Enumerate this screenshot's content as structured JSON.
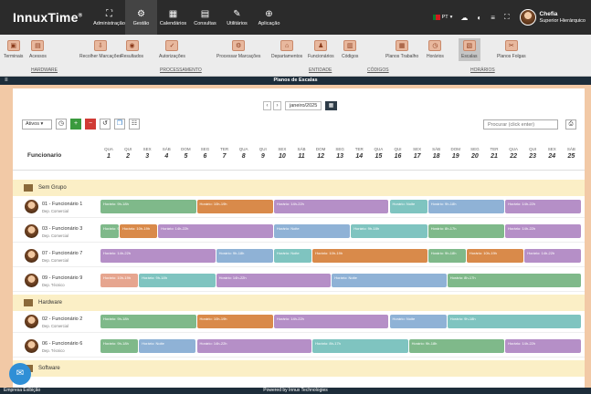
{
  "app": {
    "logo": "InnuxTime",
    "logo_mark": "®"
  },
  "modules": [
    {
      "label": "Administração",
      "icon": "sitemap-icon",
      "glyph": "⛶"
    },
    {
      "label": "Gestão",
      "icon": "gears-icon",
      "glyph": "⚙",
      "active": true
    },
    {
      "label": "Calendários",
      "icon": "calendar-icon",
      "glyph": "▦"
    },
    {
      "label": "Consultas",
      "icon": "report-icon",
      "glyph": "▤"
    },
    {
      "label": "Utilitários",
      "icon": "tools-icon",
      "glyph": "✎"
    },
    {
      "label": "Aplicação",
      "icon": "globe-icon",
      "glyph": "⊕"
    }
  ],
  "topright": {
    "lang": "PT",
    "user_name": "Chefia",
    "user_role": "Superior Hierárquico"
  },
  "submenu": {
    "items": [
      {
        "label": "Terminais",
        "icon": "terminal-icon"
      },
      {
        "label": "Acessos",
        "icon": "access-icon"
      },
      {
        "label": "Recolher Marcações",
        "icon": "collect-icon"
      },
      {
        "label": "Resultados",
        "icon": "results-icon"
      },
      {
        "label": "Autorizações",
        "icon": "authorization-icon"
      },
      {
        "label": "Processar Marcações",
        "icon": "process-icon"
      },
      {
        "label": "Departamentos",
        "icon": "department-icon"
      },
      {
        "label": "Funcionários",
        "icon": "employee-icon"
      },
      {
        "label": "Códigos",
        "icon": "codes-icon"
      },
      {
        "label": "Planos Trabalho",
        "icon": "work-plan-icon"
      },
      {
        "label": "Horários",
        "icon": "schedule-icon"
      },
      {
        "label": "Escalas",
        "icon": "rota-icon",
        "active": true
      },
      {
        "label": "Planos Folgas",
        "icon": "day-off-icon"
      }
    ],
    "groups": [
      "HARDWARE",
      "PROCESSAMENTO",
      "ENTIDADE",
      "CÓDIGOS",
      "HORÁRIOS"
    ]
  },
  "page_title": "Planos de Escalas",
  "date_nav": {
    "value": "janeiro/2025"
  },
  "filter": {
    "value": "Ativos"
  },
  "search": {
    "placeholder": "Procurar (click enter)"
  },
  "grid": {
    "column_header": "Funcionario",
    "weekdays": [
      "QUA",
      "QUI",
      "SEX",
      "SÁB",
      "DOM",
      "SEG",
      "TER",
      "QUA",
      "QUI",
      "SEX",
      "SÁB",
      "DOM",
      "SEG",
      "TER",
      "QUA",
      "QUI",
      "SEX",
      "SÁB",
      "DOM",
      "SEG",
      "TER",
      "QUA",
      "QUI",
      "SEX",
      "SÁB"
    ],
    "days": [
      "1",
      "2",
      "3",
      "4",
      "5",
      "6",
      "7",
      "8",
      "9",
      "10",
      "11",
      "12",
      "13",
      "14",
      "15",
      "16",
      "17",
      "18",
      "19",
      "20",
      "21",
      "22",
      "23",
      "24",
      "25"
    ]
  },
  "groups": [
    {
      "name": "Sem Grupo",
      "employees": [
        {
          "name": "01 - Funcionário 1",
          "dept": "Dep. Comercial"
        },
        {
          "name": "03 - Funcionário 3",
          "dept": "Dep. Comercial"
        },
        {
          "name": "07 - Funcionário 7",
          "dept": "Dep. Comercial"
        },
        {
          "name": "09 - Funcionário 9",
          "dept": "Dep. Técnico"
        }
      ]
    },
    {
      "name": "Hardware",
      "employees": [
        {
          "name": "02 - Funcionário 2",
          "dept": "Dep. Comercial"
        },
        {
          "name": "06 - Funcionário 6",
          "dept": "Dep. Técnico"
        }
      ]
    },
    {
      "name": "Software",
      "employees": []
    }
  ],
  "shifts": {
    "h1": "Horário: 9h-18h",
    "h2": "Horário: 10h-19h",
    "h3": "Horário: 14h-22h",
    "h4": "Horário: Noite",
    "h5": "Horário: 8h-17h"
  },
  "colors": {
    "green": "#7fb98a",
    "orange": "#d98a4a",
    "purple": "#b58fc7",
    "teal": "#7fc4c0",
    "blue": "#8fb2d6",
    "peach": "#e6a58f"
  },
  "footer": {
    "left": "Empresa Exibição",
    "center": "Powered by Innux Technologies"
  }
}
